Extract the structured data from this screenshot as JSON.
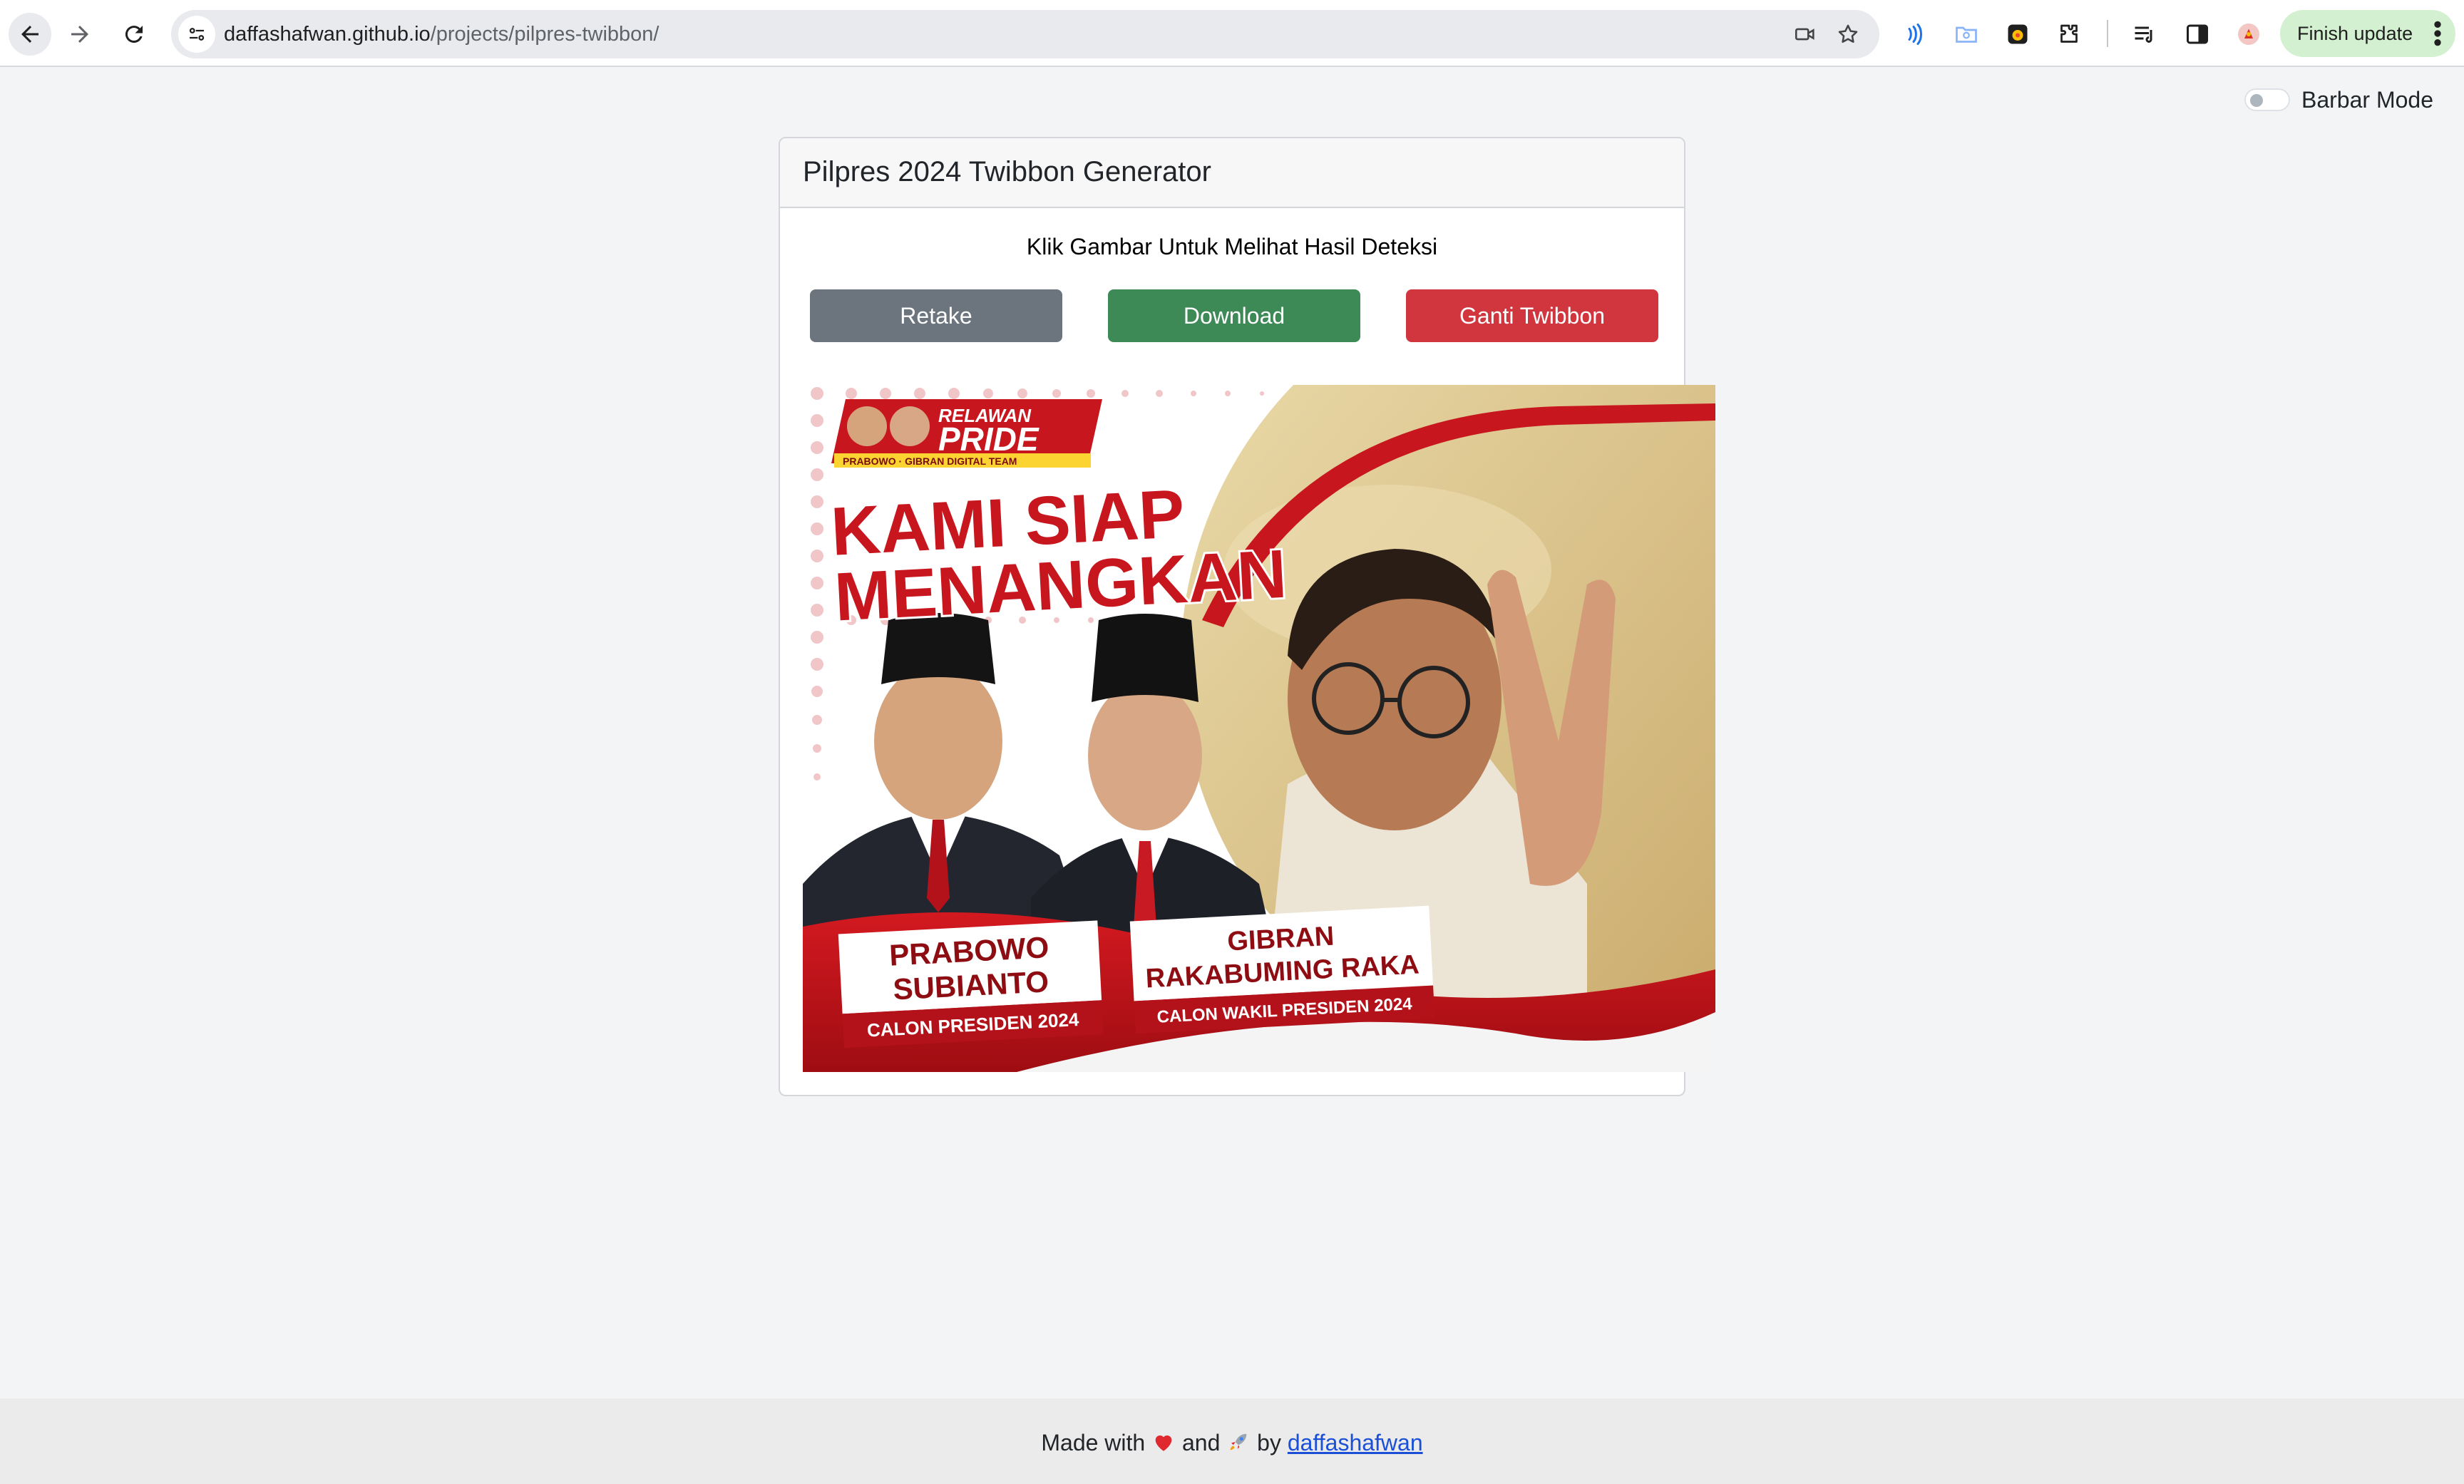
{
  "browser": {
    "url_host": "daffashafwan.github.io",
    "url_path": "/projects/pilpres-twibbon/",
    "finish_update_label": "Finish update",
    "icons": [
      "back-arrow-icon",
      "forward-arrow-icon",
      "reload-icon",
      "site-info-icon",
      "camera-icon",
      "star-icon",
      "read-aloud-icon",
      "folder-icon",
      "extension-badge-icon",
      "puzzle-icon",
      "reading-list-icon",
      "side-panel-icon",
      "profile-avatar-icon",
      "more-vert-icon"
    ]
  },
  "page": {
    "mode_toggle_label": "Barbar Mode",
    "card_title": "Pilpres 2024 Twibbon Generator",
    "hint": "Klik Gambar Untuk Melihat Hasil Deteksi",
    "buttons": {
      "retake": "Retake",
      "download": "Download",
      "ganti": "Ganti Twibbon"
    },
    "twibbon": {
      "badge_top": "RELAWAN",
      "badge_main": "PRIDE",
      "badge_sub": "PRABOWO · GIBRAN DIGITAL TEAM",
      "headline_line1": "KAMI SIAP",
      "headline_line2": "MENANGKAN",
      "candidate1_name_line1": "PRABOWO",
      "candidate1_name_line2": "SUBIANTO",
      "candidate1_role": "CALON PRESIDEN 2024",
      "candidate2_name_line1": "GIBRAN",
      "candidate2_name_line2": "RAKABUMING RAKA",
      "candidate2_role": "CALON WAKIL PRESIDEN 2024"
    }
  },
  "footer": {
    "text_made_with": "Made with",
    "text_and": "and",
    "text_by": "by",
    "link": "daffashafwan"
  },
  "colors": {
    "retake": "#6c757d",
    "download": "#3d8a57",
    "ganti": "#d1363f",
    "twibbon_red": "#c8161e",
    "link": "#1a4fd6"
  }
}
